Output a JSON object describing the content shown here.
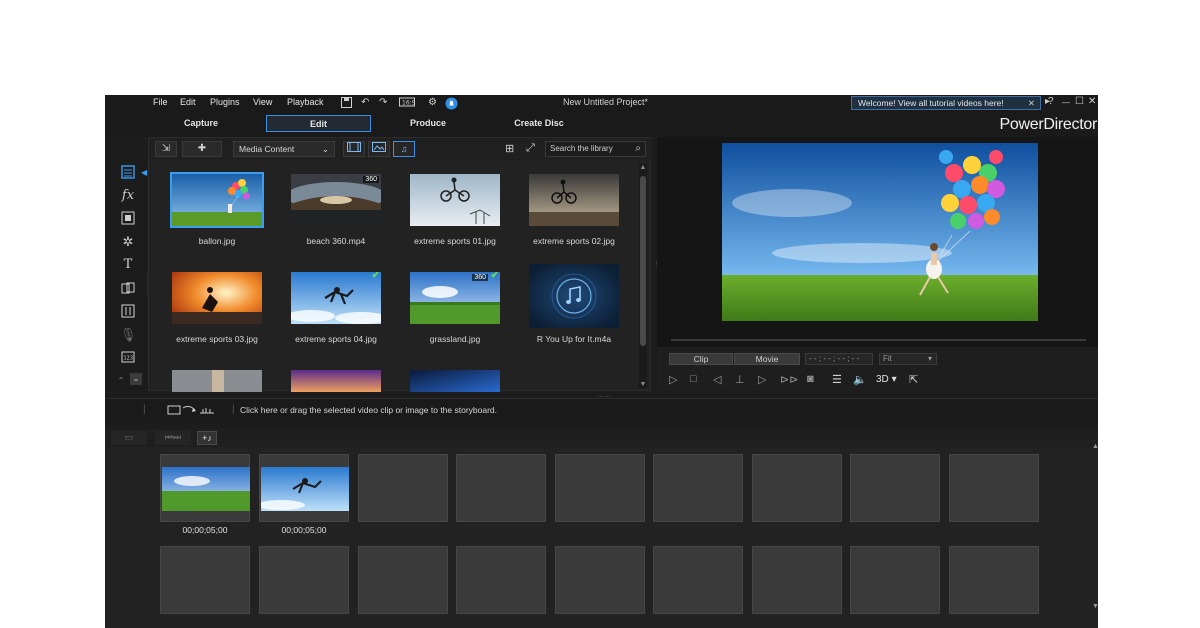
{
  "menu": {
    "items": [
      "File",
      "Edit",
      "Plugins",
      "View",
      "Playback"
    ],
    "project_title": "New Untitled Project*",
    "welcome_banner": "Welcome! View all tutorial videos here!",
    "close_glyph": "✕",
    "help_glyph": "?",
    "minimize_glyph": "—",
    "maximize_glyph": "☐",
    "close_window_glyph": "✕"
  },
  "modes": {
    "tabs": [
      "Capture",
      "Edit",
      "Produce",
      "Create Disc"
    ],
    "active": "Edit",
    "brand": "PowerDirector"
  },
  "library": {
    "content_select": "Media Content",
    "search_placeholder": "Search the library",
    "items": [
      {
        "label": "ballon.jpg",
        "badge": "",
        "check": "",
        "selected": true
      },
      {
        "label": "beach 360.mp4",
        "badge": "360",
        "check": ""
      },
      {
        "label": "extreme sports 01.jpg",
        "badge": "",
        "check": ""
      },
      {
        "label": "extreme sports 02.jpg",
        "badge": "",
        "check": ""
      },
      {
        "label": "extreme sports 03.jpg",
        "badge": "",
        "check": ""
      },
      {
        "label": "extreme sports 04.jpg",
        "badge": "",
        "check": "✔"
      },
      {
        "label": "grassland.jpg",
        "badge": "360",
        "check": "✔"
      },
      {
        "label": "R You Up for It.m4a",
        "badge": "",
        "check": ""
      }
    ]
  },
  "preview": {
    "clip_label": "Clip",
    "movie_label": "Movie",
    "timecode": "- - ; - - ; - - ; - -",
    "fit_label": "Fit",
    "mode_3d": "3D"
  },
  "storyboard": {
    "hint": "Click here or drag the selected video clip or image to the storyboard.",
    "clips": [
      {
        "duration": "00;00;05;00"
      },
      {
        "duration": "00;00;05;00"
      }
    ]
  },
  "colors": {
    "accent": "#3b9cf0",
    "check": "#5ddc5d",
    "background": "#1c1c1c"
  }
}
